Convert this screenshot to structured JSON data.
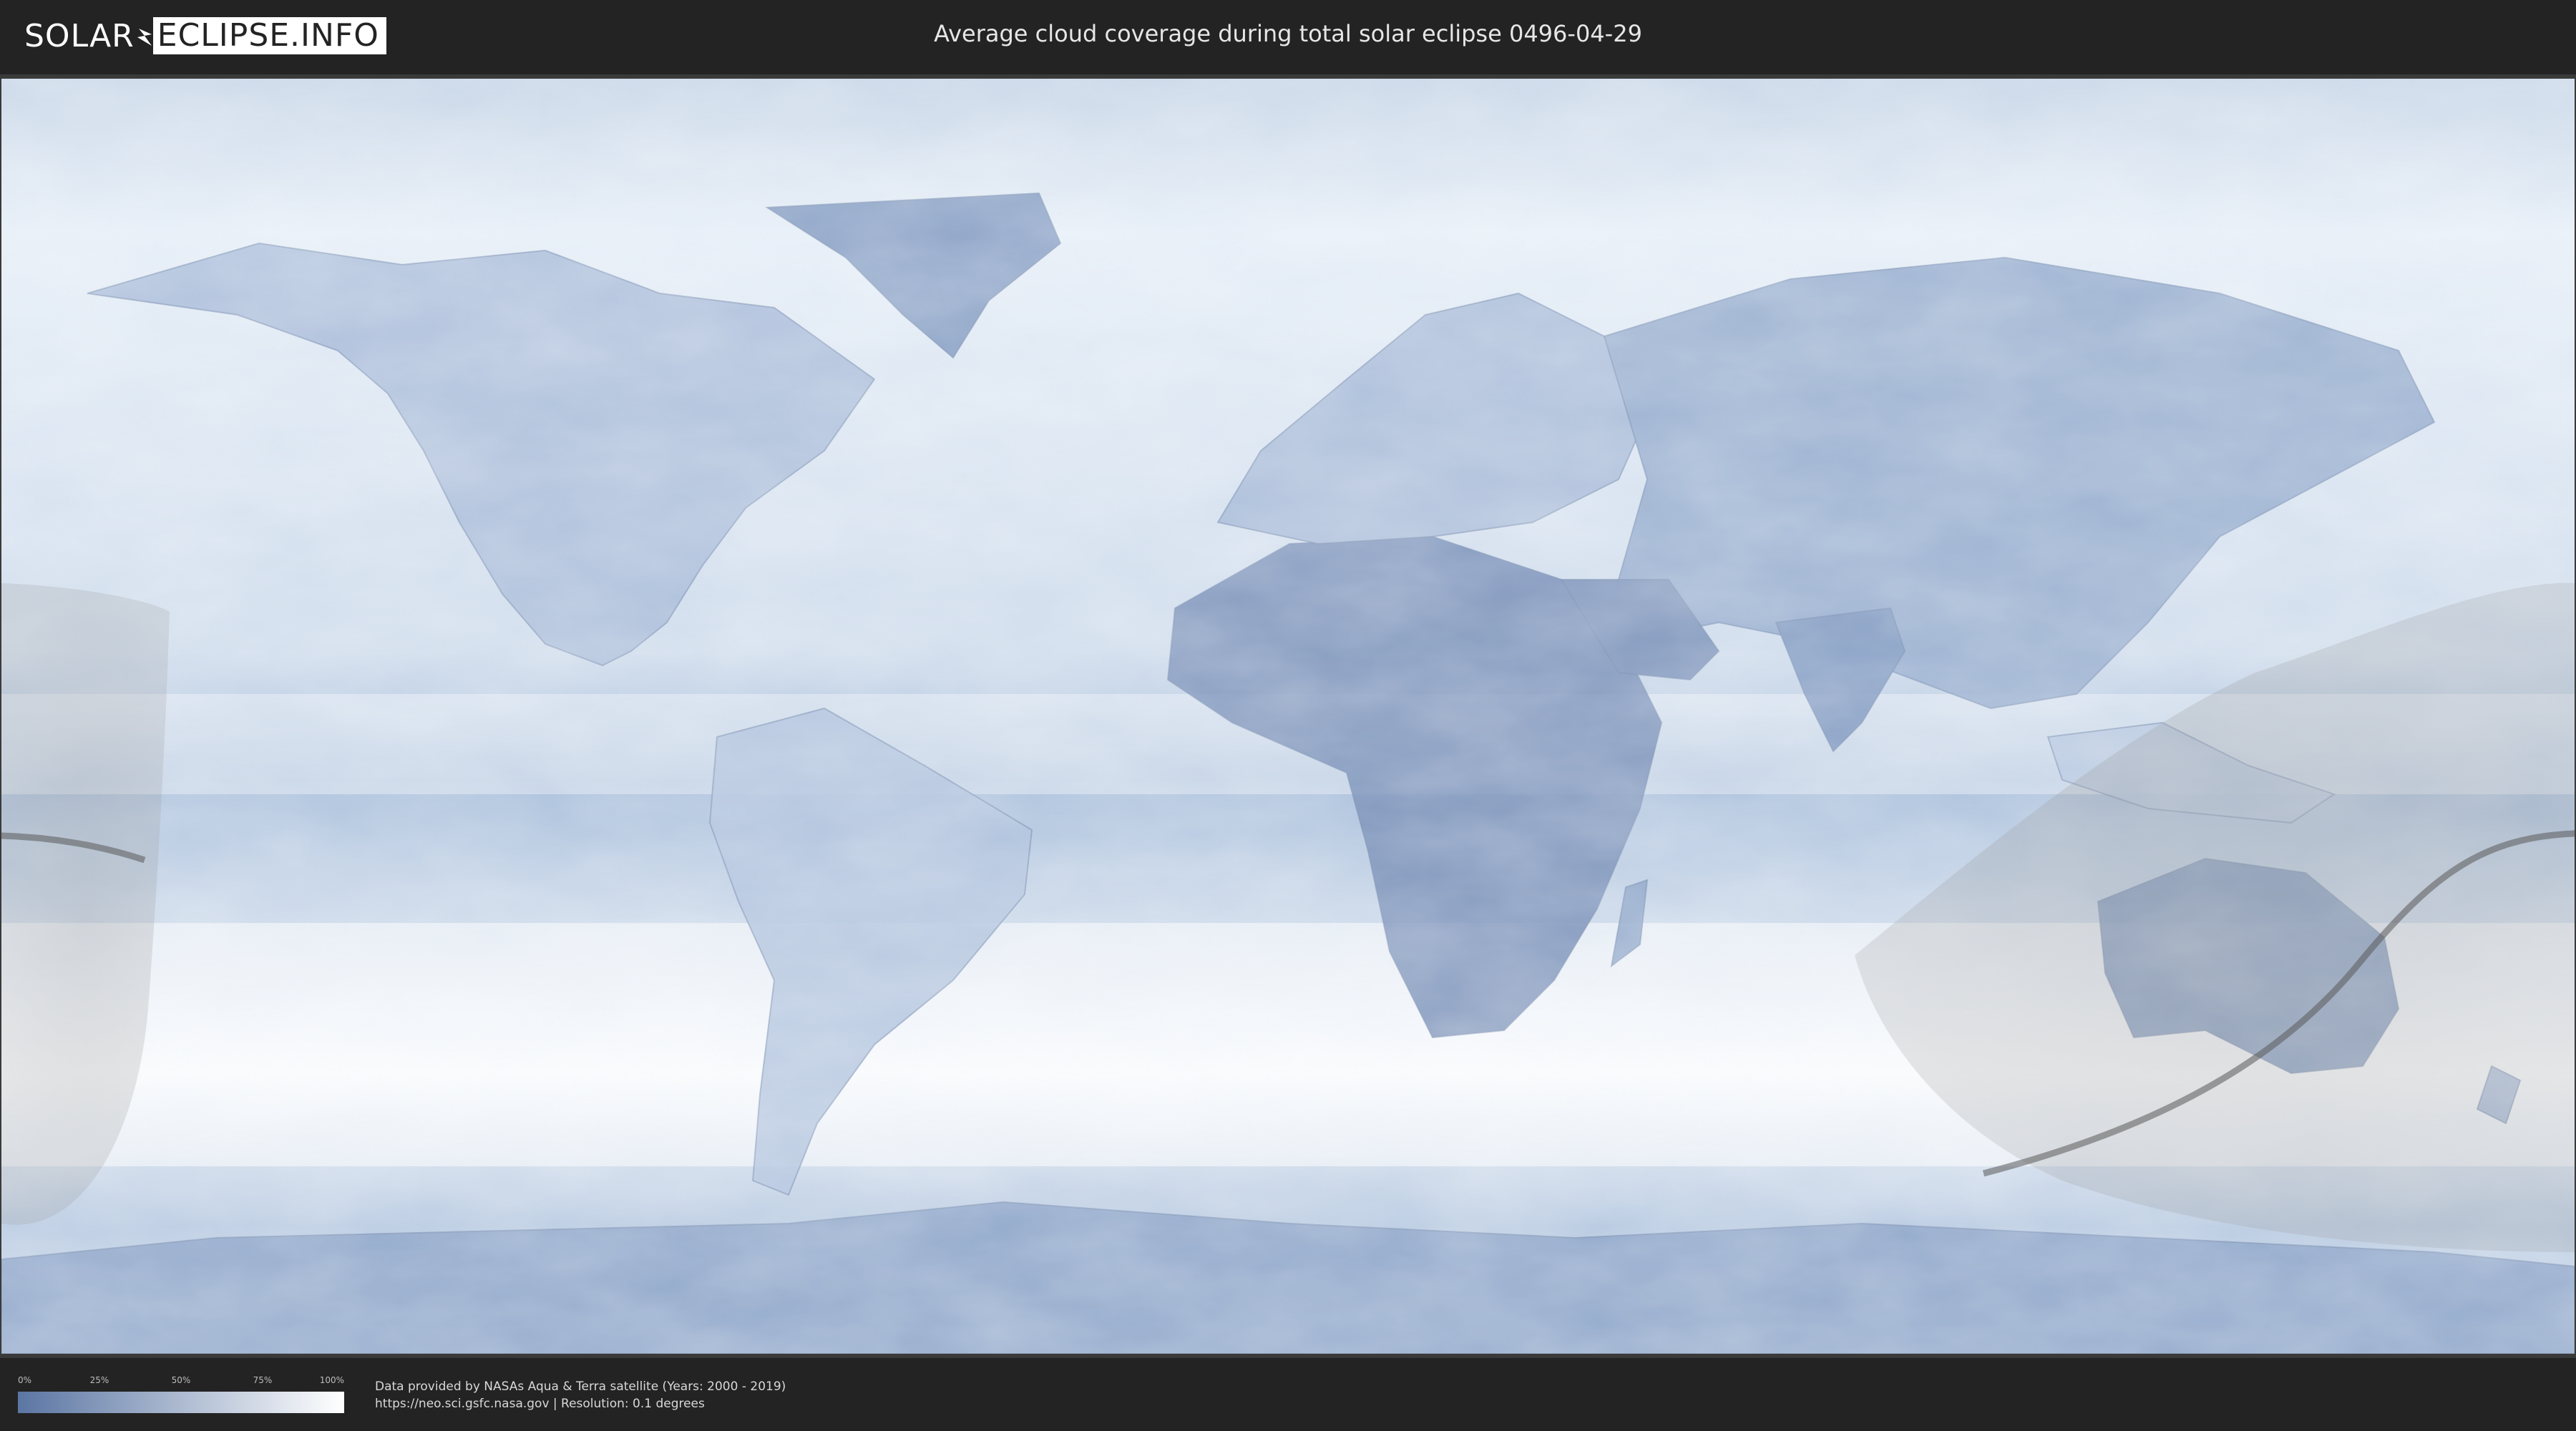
{
  "header": {
    "logo_part1": "SOLAR",
    "logo_part2": "ECLIPSE.INFO",
    "title": "Average cloud coverage during total solar eclipse 0496-04-29"
  },
  "map": {
    "icon": "world-map",
    "colors": {
      "clear_sky": "#5b76a3",
      "overcast": "#ffffff",
      "penumbra_shade": "#8f8f8f",
      "totality_path": "#5a5a5a"
    }
  },
  "legend": {
    "ticks": [
      "0%",
      "25%",
      "50%",
      "75%",
      "100%"
    ],
    "gradient": [
      "#5b76a3",
      "#ffffff"
    ]
  },
  "attribution": {
    "line1": "Data provided by NASAs Aqua & Terra satellite (Years: 2000 - 2019)",
    "line2": "https://neo.sci.gsfc.nasa.gov | Resolution: 0.1 degrees"
  }
}
